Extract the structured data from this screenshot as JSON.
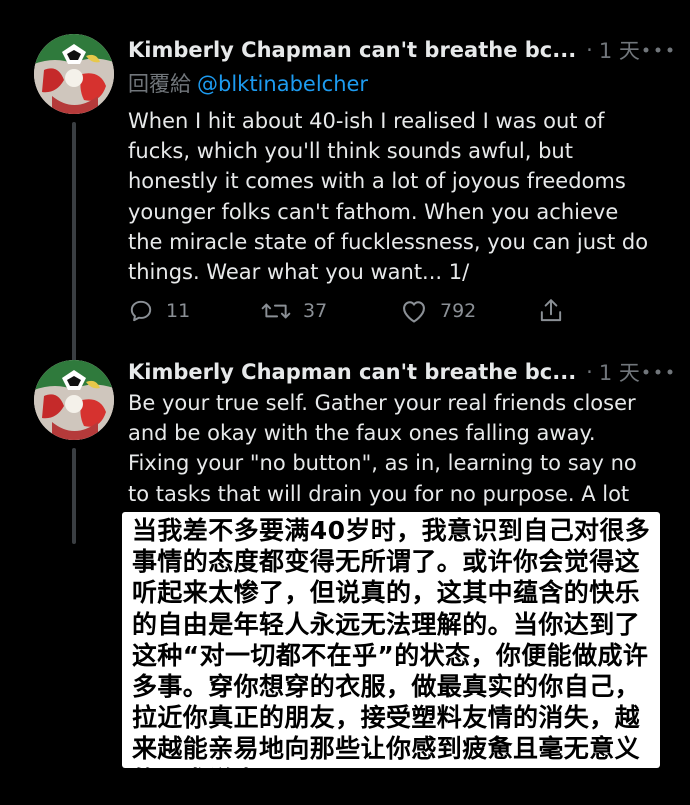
{
  "tweets": [
    {
      "author": "Kimberly Chapman can't breathe bc...",
      "separator": "·",
      "time": "1 天",
      "reply_label": "回覆給",
      "reply_handle": "@blktinabelcher",
      "body": "When I hit about 40-ish I realised I was out of fucks, which you'll think sounds awful, but honestly it comes with a lot of joyous freedoms younger folks can't fathom. When you achieve the miracle state of fucklessness, you can just do things. Wear what you want... 1/",
      "actions": {
        "replies": "11",
        "retweets": "37",
        "likes": "792"
      }
    },
    {
      "author": "Kimberly Chapman can't breathe bc...",
      "separator": "·",
      "time": "1 天",
      "body": "Be your true self. Gather your real friends closer and be okay with the faux ones falling away. Fixing your \"no button\", as in, learning to say no to tasks that will drain you for no purpose. A lot"
    }
  ],
  "caption": {
    "text": "当我差不多要满40岁时，我意识到自己对很多事情的态度都变得无所谓了。或许你会觉得这听起来太惨了，但说真的，这其中蕴含的快乐的自由是年轻人永远无法理解的。当你达到了这种“对一切都不在乎”的状态，你便能做成许多事。穿你想穿的衣服，做最真实的你自己，拉近你真正的朋友，接受塑料友情的消失，越来越能亲易地向那些让你感到疲惫且毫无意义的要求说出“不”。"
  },
  "icons": {
    "reply": "reply-icon",
    "retweet": "retweet-icon",
    "like": "heart-icon",
    "share": "share-icon",
    "more": "more-icon"
  },
  "colors": {
    "background": "#000000",
    "text": "#e7e9ea",
    "secondary": "#71767b",
    "link": "#1d9bf0",
    "thread_line": "#3a3e42",
    "caption_background": "#ffffff",
    "caption_text": "#000000"
  }
}
